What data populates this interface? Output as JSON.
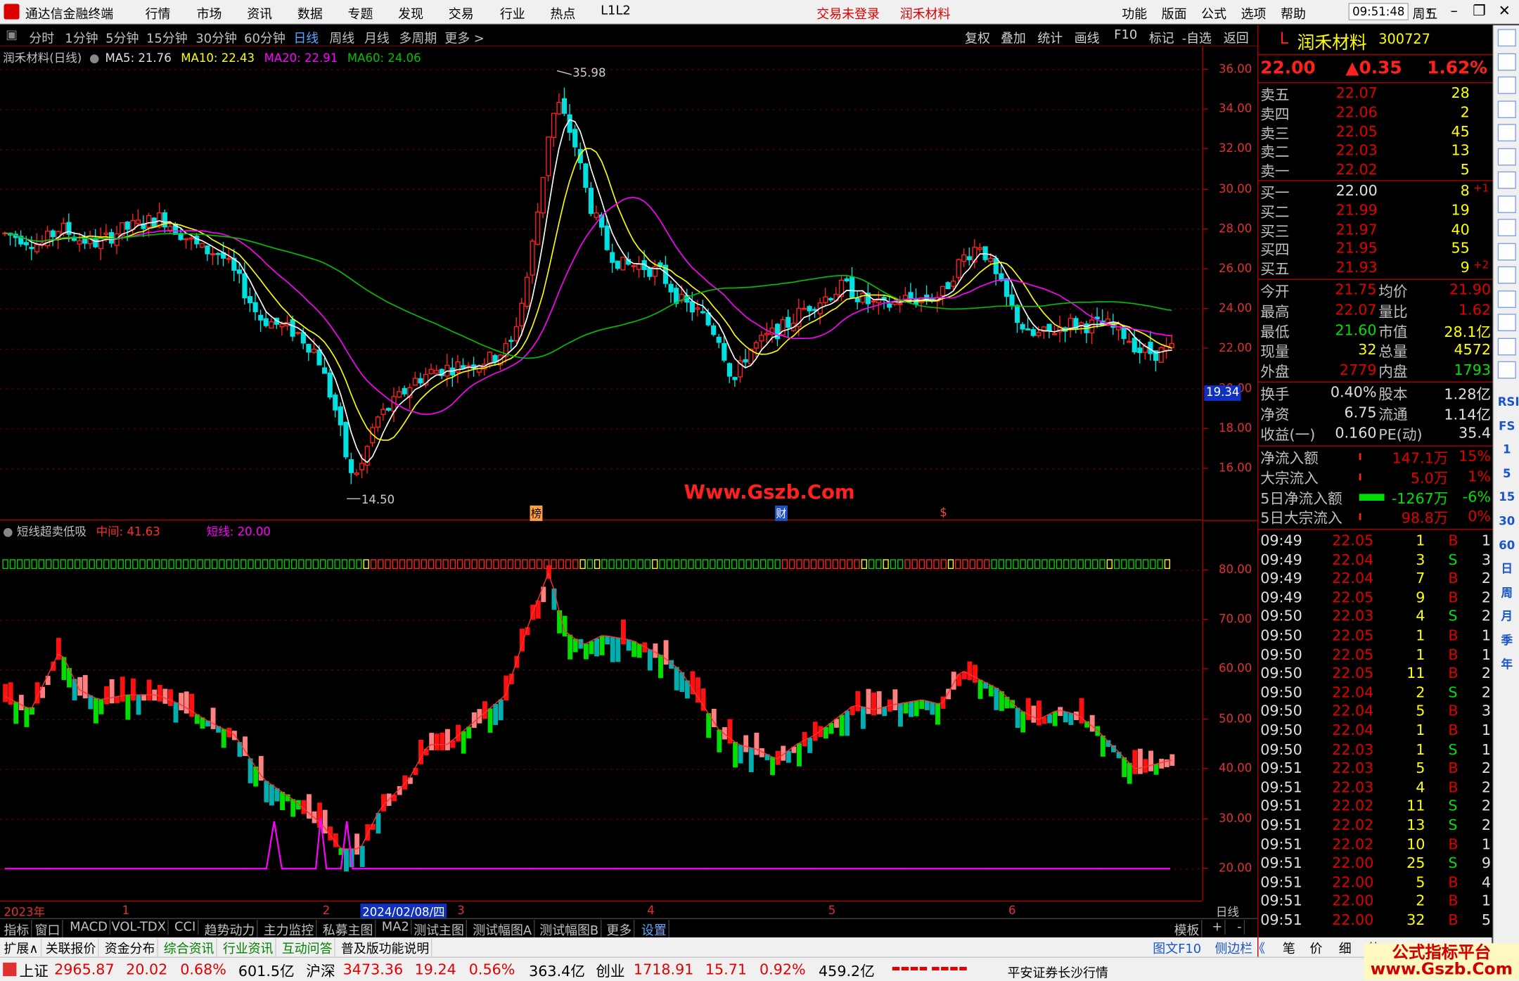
{
  "window": {
    "app_title": "通达信金融终端",
    "menu": [
      "行情",
      "市场",
      "资讯",
      "数据",
      "专题",
      "发现",
      "交易",
      "行业",
      "热点",
      "L1L2"
    ],
    "notice": [
      "交易未登录",
      "润禾材料"
    ],
    "right_menu": [
      "功能",
      "版面",
      "公式",
      "选项",
      "帮助"
    ],
    "time": "09:51:48",
    "weekday": "周五"
  },
  "periods": [
    "分时",
    "1分钟",
    "5分钟",
    "15分钟",
    "30分钟",
    "60分钟",
    "日线",
    "周线",
    "月线",
    "多周期",
    "更多 >"
  ],
  "active_period": "日线",
  "toolbar_right": [
    "复权",
    "叠加",
    "统计",
    "画线",
    "F10",
    "标记",
    "-自选",
    "返回"
  ],
  "main_info": {
    "name": "润禾材料(日线)",
    "ma5": "MA5: 21.76",
    "ma10": "MA10: 22.43",
    "ma20": "MA20: 22.91",
    "ma60": "MA60: 24.06"
  },
  "price_axis": [
    "36.00",
    "34.00",
    "32.00",
    "30.00",
    "28.00",
    "26.00",
    "24.00",
    "22.00",
    "20.00",
    "18.00",
    "16.00"
  ],
  "price_marker": "19.34",
  "annotations": {
    "high": "35.98",
    "low": "14.50",
    "watermark": "Www.Gszb.Com",
    "tag1": "榜",
    "tag2": "财",
    "tag3": "$"
  },
  "indicator": {
    "name": "短线超卖低吸",
    "mid": "中间: 41.63",
    "short": "短线: 20.00"
  },
  "ind_axis": [
    "80.00",
    "70.00",
    "60.00",
    "50.00",
    "40.00",
    "30.00",
    "20.00"
  ],
  "date_axis": [
    "2023年",
    "1",
    "2",
    "2024/02/08/四",
    "3",
    "4",
    "5",
    "6"
  ],
  "date_axis_right": "日线",
  "tabs": [
    "指标",
    "窗口",
    "MACD",
    "VOL-TDX",
    "CCI",
    "趋势动力",
    "主力监控",
    "私募主图",
    "MA2",
    "测试主图",
    "测试幅图A",
    "测试幅图B",
    "更多",
    "设置"
  ],
  "tabs_right": [
    "模板",
    "+",
    "-"
  ],
  "tabs2": [
    "扩展∧",
    "关联报价",
    "资金分布",
    "综合资讯",
    "行业资讯",
    "互动问答",
    "普及版功能说明"
  ],
  "tabs2_right": [
    "图文F10",
    "侧边栏《",
    "笔",
    "价",
    "细",
    "势"
  ],
  "quote": {
    "flag": "L",
    "name": "润禾材料",
    "code": "300727",
    "price": "22.00",
    "change": "▲0.35",
    "pct": "1.62%",
    "asks": [
      [
        "卖五",
        "22.07",
        "28"
      ],
      [
        "卖四",
        "22.06",
        "2"
      ],
      [
        "卖三",
        "22.05",
        "45"
      ],
      [
        "卖二",
        "22.03",
        "13"
      ],
      [
        "卖一",
        "22.02",
        "5"
      ]
    ],
    "bids": [
      [
        "买一",
        "22.00",
        "8",
        "+1"
      ],
      [
        "买二",
        "21.99",
        "19",
        ""
      ],
      [
        "买三",
        "21.97",
        "40",
        ""
      ],
      [
        "买四",
        "21.95",
        "55",
        ""
      ],
      [
        "买五",
        "21.93",
        "9",
        "+2"
      ]
    ],
    "stats": [
      [
        "今开",
        "21.75",
        "均价",
        "21.90"
      ],
      [
        "最高",
        "22.07",
        "量比",
        "1.62"
      ],
      [
        "最低",
        "21.60",
        "市值",
        "28.1亿"
      ],
      [
        "现量",
        "32",
        "总量",
        "4572"
      ],
      [
        "外盘",
        "2779",
        "内盘",
        "1793"
      ]
    ],
    "stats2": [
      [
        "换手",
        "0.40%",
        "股本",
        "1.28亿"
      ],
      [
        "净资",
        "6.75",
        "流通",
        "1.14亿"
      ],
      [
        "收益(一)",
        "0.160",
        "PE(动)",
        "35.4"
      ]
    ],
    "flows": [
      [
        "净流入额",
        "147.1万",
        "15%"
      ],
      [
        "大宗流入",
        "5.0万",
        "1%"
      ],
      [
        "5日净流入额",
        "-1267万",
        "-6%"
      ],
      [
        "5日大宗流入",
        "98.8万",
        "0%"
      ]
    ],
    "ticks": [
      [
        "09:49",
        "22.05",
        "1",
        "B",
        "1"
      ],
      [
        "09:49",
        "22.04",
        "3",
        "S",
        "3"
      ],
      [
        "09:49",
        "22.04",
        "7",
        "B",
        "2"
      ],
      [
        "09:49",
        "22.05",
        "9",
        "B",
        "2"
      ],
      [
        "09:50",
        "22.03",
        "4",
        "S",
        "2"
      ],
      [
        "09:50",
        "22.05",
        "1",
        "B",
        "1"
      ],
      [
        "09:50",
        "22.05",
        "1",
        "B",
        "1"
      ],
      [
        "09:50",
        "22.05",
        "11",
        "B",
        "2"
      ],
      [
        "09:50",
        "22.04",
        "2",
        "S",
        "2"
      ],
      [
        "09:50",
        "22.04",
        "5",
        "B",
        "3"
      ],
      [
        "09:50",
        "22.04",
        "1",
        "B",
        "1"
      ],
      [
        "09:50",
        "22.03",
        "1",
        "S",
        "1"
      ],
      [
        "09:51",
        "22.03",
        "5",
        "B",
        "2"
      ],
      [
        "09:51",
        "22.03",
        "4",
        "B",
        "2"
      ],
      [
        "09:51",
        "22.02",
        "11",
        "S",
        "2"
      ],
      [
        "09:51",
        "22.02",
        "13",
        "S",
        "2"
      ],
      [
        "09:51",
        "22.02",
        "10",
        "B",
        "1"
      ],
      [
        "09:51",
        "22.00",
        "25",
        "S",
        "9"
      ],
      [
        "09:51",
        "22.00",
        "5",
        "B",
        "4"
      ],
      [
        "09:51",
        "22.00",
        "2",
        "B",
        "1"
      ],
      [
        "09:51",
        "22.00",
        "32",
        "B",
        "5"
      ]
    ]
  },
  "sidebar_labels": [
    "RSI",
    "FS",
    "1",
    "5",
    "15",
    "30",
    "60",
    "日",
    "周",
    "月",
    "季",
    "年"
  ],
  "status": {
    "indices": [
      [
        "上证",
        "2965.87",
        "20.02",
        "0.68%",
        "601.5亿"
      ],
      [
        "沪深",
        "3473.36",
        "19.24",
        "0.56%",
        "363.4亿"
      ],
      [
        "创业",
        "1718.91",
        "15.71",
        "0.92%",
        "459.2亿"
      ]
    ],
    "broker": "平安证券长沙行情",
    "watermark": "公式指标平台\nwww.Gszb.Com"
  },
  "colors": {
    "up": "#ff2020",
    "down": "#00e0e0",
    "ma5": "#ffffff",
    "ma10": "#ffff00",
    "ma20": "#ff00ff",
    "ma60": "#00c000"
  }
}
